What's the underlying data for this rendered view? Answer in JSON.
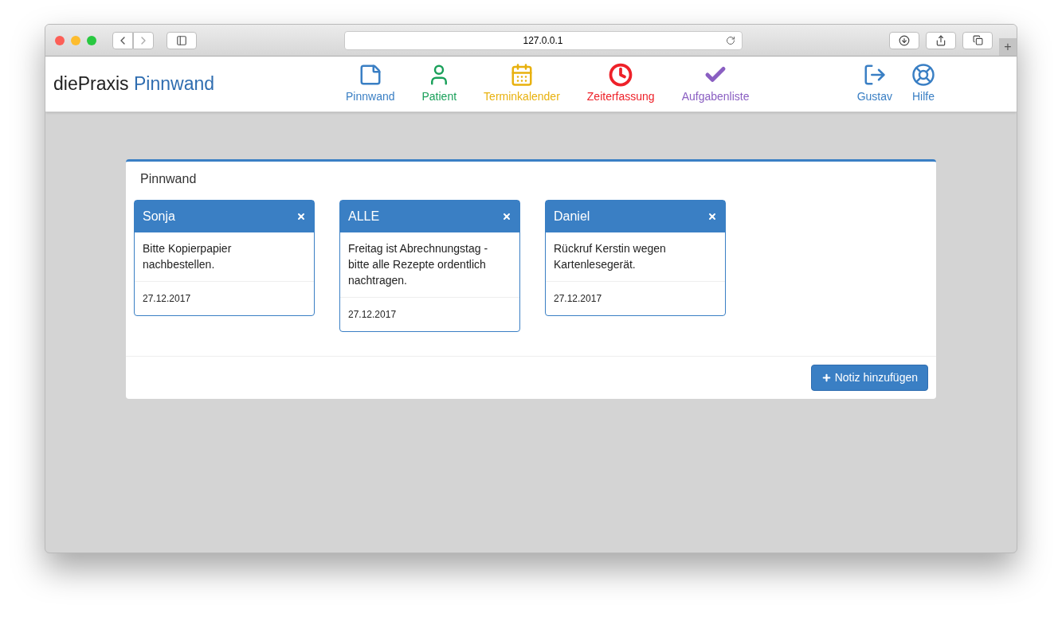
{
  "browser": {
    "address": "127.0.0.1",
    "new_tab": "+"
  },
  "app": {
    "brand": "diePraxis",
    "brand_accent": "Pinnwand"
  },
  "nav": [
    {
      "kind": "note",
      "label": "Pinnwand",
      "color": "#3a7fc4"
    },
    {
      "kind": "user",
      "label": "Patient",
      "color": "#1aa05a"
    },
    {
      "kind": "calendar",
      "label": "Terminkalender",
      "color": "#e8b10e"
    },
    {
      "kind": "clock",
      "label": "Zeiterfassung",
      "color": "#ee2129"
    },
    {
      "kind": "check",
      "label": "Aufgabenliste",
      "color": "#8a5fc2"
    }
  ],
  "nav_right": [
    {
      "kind": "logout",
      "label": "Gustav"
    },
    {
      "kind": "help",
      "label": "Hilfe"
    }
  ],
  "panel": {
    "title": "Pinnwand",
    "button": "Notiz hinzufügen"
  },
  "notes": [
    {
      "recipient": "Sonja",
      "text": "Bitte Kopierpapier nachbestellen.",
      "date": "27.12.2017"
    },
    {
      "recipient": "ALLE",
      "text": "Freitag ist Abrechnungstag - bitte alle Rezepte ordentlich nachtragen.",
      "date": "27.12.2017"
    },
    {
      "recipient": "Daniel",
      "text": "Rückruf Kerstin wegen Kartenlesegerät.",
      "date": "27.12.2017"
    }
  ]
}
